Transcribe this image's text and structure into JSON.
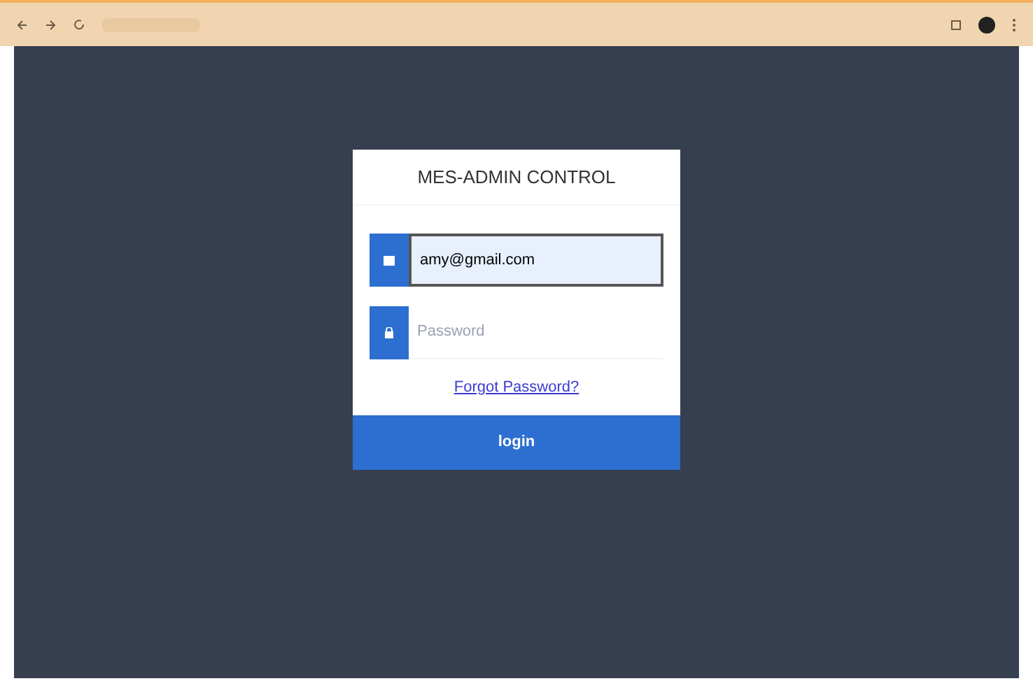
{
  "login": {
    "title": "MES-ADMIN CONTROL",
    "email": {
      "value": "amy@gmail.com",
      "focused": true
    },
    "password": {
      "placeholder": "Password"
    },
    "forgot_link": "Forgot Password?",
    "submit": "login"
  }
}
